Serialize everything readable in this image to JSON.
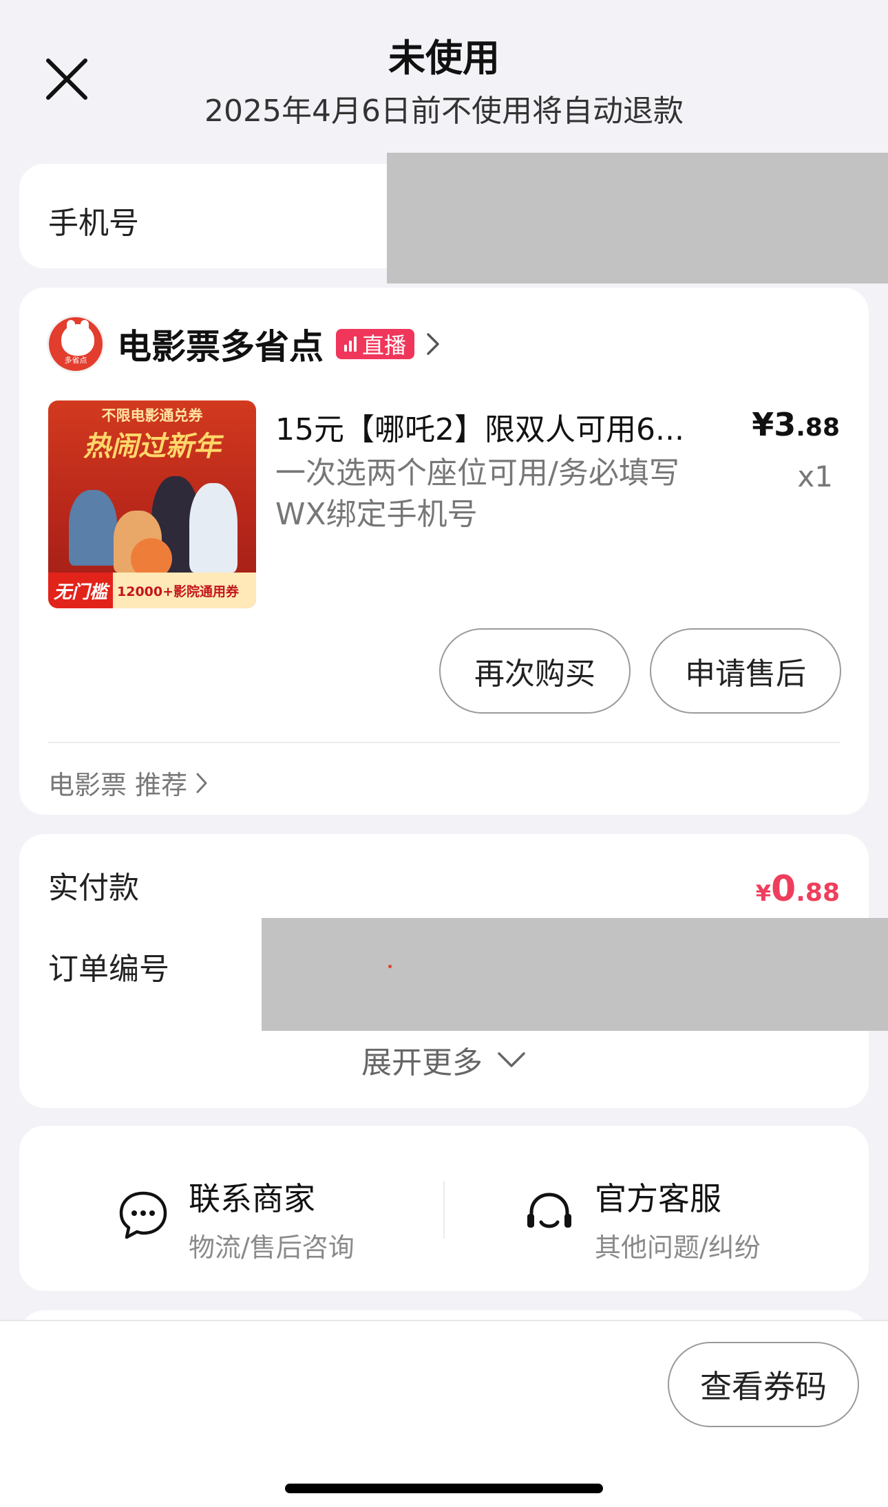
{
  "header": {
    "title": "未使用",
    "subtitle": "2025年4月6日前不使用将自动退款"
  },
  "phone_section": {
    "label": "手机号"
  },
  "shop": {
    "name": "电影票多省点",
    "avatar_caption": "多省点",
    "live_badge": "直播",
    "live_badge_color": "#f0365a"
  },
  "product": {
    "image": {
      "top_tag": "不限电影通兑券",
      "banner": "热闹过新年",
      "bottom_left": "无门槛",
      "bottom_right": "12000+影院通用券"
    },
    "title": "15元【哪吒2】限双人可用6...",
    "price_main": "¥3",
    "price_decimal": ".88",
    "description": "一次选两个座位可用/务必填写WX绑定手机号",
    "quantity": "x1",
    "buttons": {
      "rebuy": "再次购买",
      "after_sale": "申请售后"
    },
    "recommend_link": "电影票 推荐"
  },
  "payment": {
    "paid_label": "实付款",
    "paid_yen": "¥",
    "paid_main": "0",
    "paid_decimal": ".88",
    "paid_color": "#ef3e5c",
    "order_number_label": "订单编号",
    "expand_more": "展开更多"
  },
  "contact": {
    "merchant": {
      "title": "联系商家",
      "subtitle": "物流/售后咨询",
      "icon": "chat-bubble-icon"
    },
    "official": {
      "title": "官方客服",
      "subtitle": "其他问题/纠纷",
      "icon": "headset-icon"
    }
  },
  "bottom_bar": {
    "view_code_button": "查看券码"
  }
}
